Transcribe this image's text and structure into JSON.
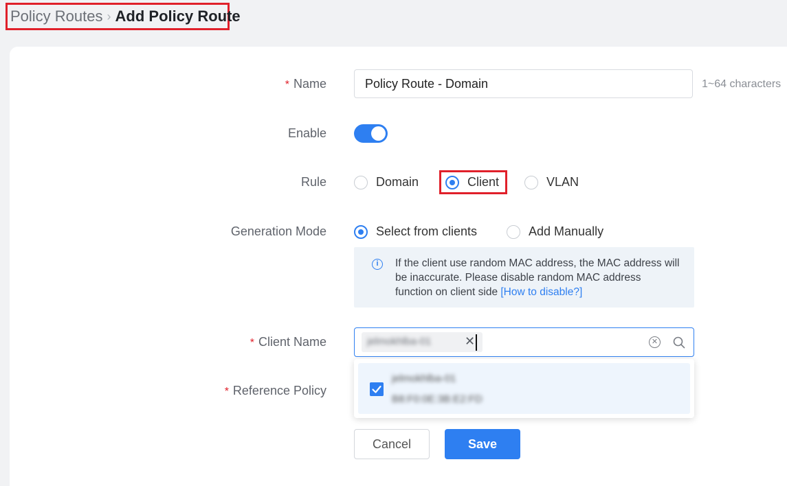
{
  "breadcrumb": {
    "parent": "Policy Routes",
    "current": "Add Policy Route"
  },
  "form": {
    "name": {
      "label": "Name",
      "value": "Policy Route - Domain",
      "hint": "1~64 characters"
    },
    "enable": {
      "label": "Enable",
      "on": true
    },
    "rule": {
      "label": "Rule",
      "options": [
        "Domain",
        "Client",
        "VLAN"
      ],
      "selected": "Client"
    },
    "generation_mode": {
      "label": "Generation Mode",
      "options": [
        "Select from clients",
        "Add Manually"
      ],
      "selected": "Select from clients",
      "notice_text": "If the client use random MAC address, the MAC address will be inaccurate. Please disable random MAC address function on client side ",
      "notice_link": "[How to disable?]"
    },
    "client_name": {
      "label": "Client Name",
      "tag": "jelmokhlba-01",
      "dropdown": {
        "name": "jelmokhlba-01",
        "mac": "B8:F0:0E:3B:E2:FD",
        "checked": true
      }
    },
    "reference_policy": {
      "label": "Reference Policy"
    }
  },
  "buttons": {
    "cancel": "Cancel",
    "save": "Save"
  },
  "icons": {
    "breadcrumb_separator": "chevron-right-icon",
    "tag_close": "close-icon",
    "clear": "clear-circle-icon",
    "search": "search-icon",
    "info": "info-icon",
    "check": "checkmark-icon"
  },
  "colors": {
    "accent": "#2e7ff1",
    "highlight": "#e0202a",
    "required": "#e0202a"
  }
}
